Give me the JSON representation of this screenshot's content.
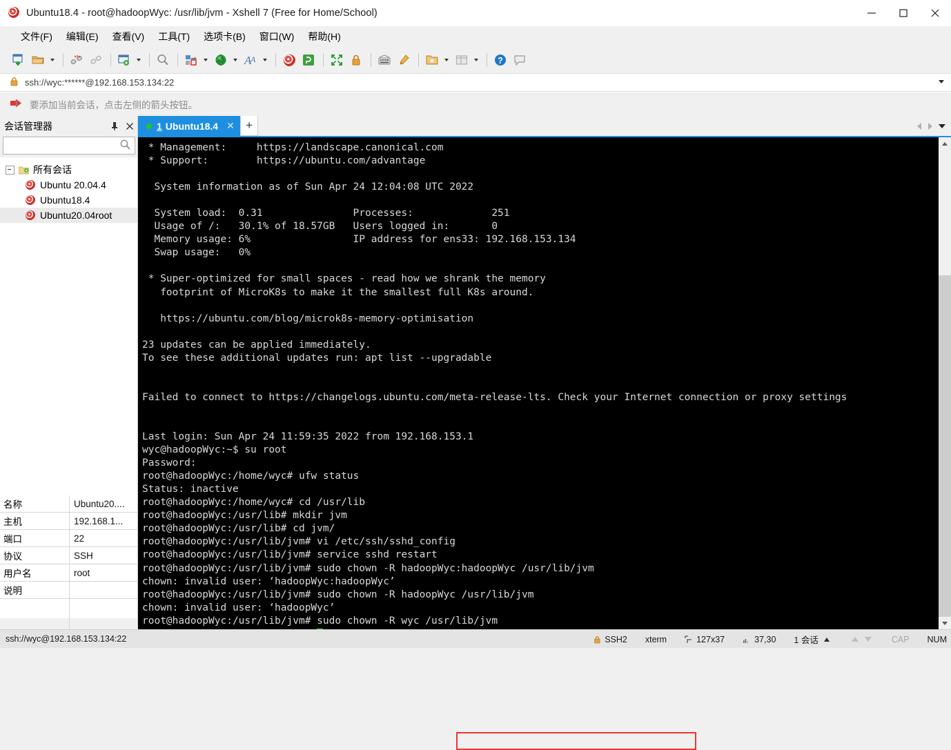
{
  "window": {
    "title": "Ubuntu18.4 - root@hadoopWyc: /usr/lib/jvm - Xshell 7 (Free for Home/School)",
    "app_icon": "xshell-spiral-icon",
    "minimize_label": "–",
    "maximize_label": "□",
    "close_label": "✕"
  },
  "menu": {
    "items": [
      {
        "label": "文件(F)",
        "name": "menu-file"
      },
      {
        "label": "编辑(E)",
        "name": "menu-edit"
      },
      {
        "label": "查看(V)",
        "name": "menu-view"
      },
      {
        "label": "工具(T)",
        "name": "menu-tools"
      },
      {
        "label": "选项卡(B)",
        "name": "menu-tabs"
      },
      {
        "label": "窗口(W)",
        "name": "menu-window"
      },
      {
        "label": "帮助(H)",
        "name": "menu-help"
      }
    ]
  },
  "toolbar": {
    "icons": [
      "new-session-icon",
      "open-folder-icon",
      "dropdown-caret",
      "separator",
      "disconnect-icon",
      "reconnect-icon",
      "separator",
      "session-properties-icon",
      "dropdown-caret",
      "separator",
      "find-icon",
      "separator",
      "transfer-icon",
      "dropdown-caret",
      "globe-icon",
      "dropdown-caret",
      "font-icon",
      "dropdown-caret",
      "separator",
      "xshell-icon",
      "xftp-icon",
      "separator",
      "fullscreen-icon",
      "lock-icon",
      "separator",
      "keyboard-icon",
      "highlight-icon",
      "separator",
      "compose-icon",
      "dropdown-caret",
      "layout-icon",
      "dropdown-caret",
      "separator",
      "help-icon",
      "feedback-icon"
    ]
  },
  "address": {
    "icon": "lock-icon",
    "value": "ssh://wyc:******@192.168.153.134:22",
    "dropdown": "chevron-down-icon"
  },
  "hint": {
    "icon": "red-arrow-icon",
    "text": "要添加当前会话，点击左侧的箭头按钮。"
  },
  "session_manager": {
    "title": "会话管理器",
    "pin_icon": "pin-icon",
    "close_icon": "close-icon",
    "search_placeholder": "",
    "search_icon": "search-icon",
    "tree": {
      "root_label": "所有会话",
      "children": [
        {
          "label": "Ubuntu 20.04.4",
          "selected": false
        },
        {
          "label": "Ubuntu18.4",
          "selected": false
        },
        {
          "label": "Ubuntu20.04root",
          "selected": true
        }
      ]
    },
    "properties": [
      {
        "key": "名称",
        "value": "Ubuntu20...."
      },
      {
        "key": "主机",
        "value": "192.168.1..."
      },
      {
        "key": "端口",
        "value": "22"
      },
      {
        "key": "协议",
        "value": "SSH"
      },
      {
        "key": "用户名",
        "value": "root"
      },
      {
        "key": "说明",
        "value": ""
      }
    ]
  },
  "tabs": {
    "items": [
      {
        "num": "1",
        "label": "Ubuntu18.4",
        "active": true,
        "status": "connected",
        "close_label": "✕"
      }
    ],
    "add_label": "+",
    "nav_left_icon": "chevron-left-icon",
    "nav_right_icon": "chevron-right-icon",
    "nav_menu_icon": "chevron-down-icon"
  },
  "terminal": {
    "lines": [
      " * Management:     https://landscape.canonical.com",
      " * Support:        https://ubuntu.com/advantage",
      "",
      "  System information as of Sun Apr 24 12:04:08 UTC 2022",
      "",
      "  System load:  0.31               Processes:             251",
      "  Usage of /:   30.1% of 18.57GB   Users logged in:       0",
      "  Memory usage: 6%                 IP address for ens33: 192.168.153.134",
      "  Swap usage:   0%",
      "",
      " * Super-optimized for small spaces - read how we shrank the memory",
      "   footprint of MicroK8s to make it the smallest full K8s around.",
      "",
      "   https://ubuntu.com/blog/microk8s-memory-optimisation",
      "",
      "23 updates can be applied immediately.",
      "To see these additional updates run: apt list --upgradable",
      "",
      "",
      "Failed to connect to https://changelogs.ubuntu.com/meta-release-lts. Check your Internet connection or proxy settings",
      "",
      "",
      "Last login: Sun Apr 24 11:59:35 2022 from 192.168.153.1",
      "wyc@hadoopWyc:~$ su root",
      "Password:",
      "root@hadoopWyc:/home/wyc# ufw status",
      "Status: inactive",
      "root@hadoopWyc:/home/wyc# cd /usr/lib",
      "root@hadoopWyc:/usr/lib# mkdir jvm",
      "root@hadoopWyc:/usr/lib# cd jvm/",
      "root@hadoopWyc:/usr/lib/jvm# vi /etc/ssh/sshd_config",
      "root@hadoopWyc:/usr/lib/jvm# service sshd restart",
      "root@hadoopWyc:/usr/lib/jvm# sudo chown -R hadoopWyc:hadoopWyc /usr/lib/jvm",
      "chown: invalid user: ‘hadoopWyc:hadoopWyc’",
      "root@hadoopWyc:/usr/lib/jvm# sudo chown -R hadoopWyc /usr/lib/jvm",
      "chown: invalid user: ‘hadoopWyc’",
      "root@hadoopWyc:/usr/lib/jvm# sudo chown -R wyc /usr/lib/jvm",
      "root@hadoopWyc:/usr/lib/jvm# "
    ],
    "highlight_text": "sudo chown -R wyc /usr/lib/jvm",
    "highlight_color": "#f2342f",
    "cursor_color": "#19e619",
    "bg_color": "#000000",
    "fg_color": "#d8d8d8"
  },
  "statusbar": {
    "left": "ssh://wyc@192.168.153.134:22",
    "protocol_icon": "lock-icon",
    "protocol": "SSH2",
    "term_type": "xterm",
    "size_icon": "screen-size-icon",
    "size": "127x37",
    "cursor_icon": "cursor-position-icon",
    "cursor": "37,30",
    "sessions": "1 会话",
    "sessions_caret": "caret-up-icon",
    "up_arrow_icon": "arrow-up-icon",
    "down_arrow_icon": "arrow-down-icon",
    "cap": "CAP",
    "num": "NUM"
  }
}
